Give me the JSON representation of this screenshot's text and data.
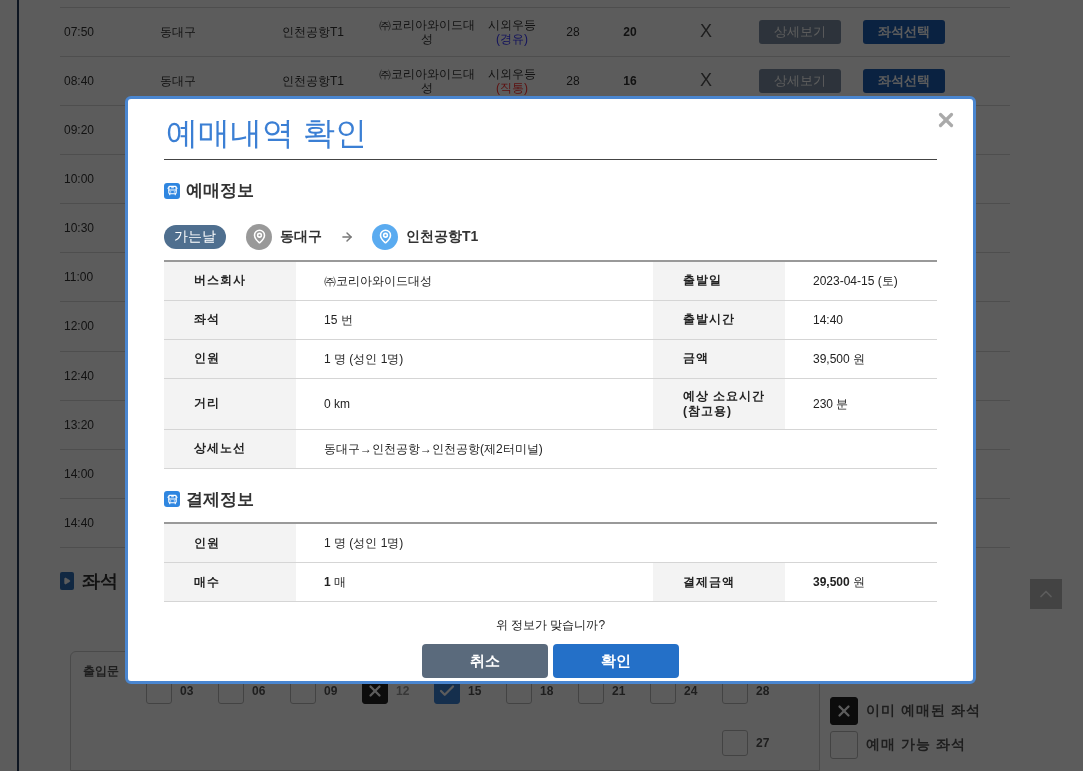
{
  "schedule": {
    "rows": [
      {
        "time": "07:50",
        "departure": "동대구",
        "arrival": "인천공항T1",
        "company": "㈜코리아와이드대성",
        "grade": "시외우등",
        "grade_note": {
          "text": "(경유)",
          "kind": "via"
        },
        "total_seats": "28",
        "remaining_seats": "20",
        "mark": "X",
        "detail_button": "상세보기",
        "select_button": "좌석선택"
      },
      {
        "time": "08:40",
        "departure": "동대구",
        "arrival": "인천공항T1",
        "company": "㈜코리아와이드대성",
        "grade": "시외우등",
        "grade_note": {
          "text": "(직통)",
          "kind": "direct"
        },
        "total_seats": "28",
        "remaining_seats": "16",
        "mark": "X",
        "detail_button": "상세보기",
        "select_button": "좌석선택"
      },
      {
        "time": "09:20"
      },
      {
        "time": "10:00"
      },
      {
        "time": "10:30"
      },
      {
        "time": "11:00"
      },
      {
        "time": "12:00"
      },
      {
        "time": "12:40"
      },
      {
        "time": "13:20"
      },
      {
        "time": "14:00"
      },
      {
        "time": "14:40"
      }
    ]
  },
  "seat_section": {
    "heading": "좌석",
    "door_label": "출입문",
    "seat_rows": [
      [
        {
          "number": "03",
          "booked": false,
          "selected": false
        },
        {
          "number": "06",
          "booked": false,
          "selected": false
        },
        {
          "number": "09",
          "booked": false,
          "selected": false
        },
        {
          "number": "12",
          "booked": true,
          "selected": false
        },
        {
          "number": "15",
          "booked": false,
          "selected": true
        },
        {
          "number": "18",
          "booked": false,
          "selected": false
        },
        {
          "number": "21",
          "booked": false,
          "selected": false
        },
        {
          "number": "24",
          "booked": false,
          "selected": false
        },
        {
          "number": "28",
          "booked": false,
          "selected": false
        }
      ],
      [
        {
          "number": "27",
          "booked": false,
          "selected": false
        }
      ]
    ],
    "legend": [
      {
        "kind": "booked",
        "label": "이미 예매된 좌석"
      },
      {
        "kind": "available",
        "label": "예매 가능 좌석"
      }
    ]
  },
  "modal": {
    "title": "예매내역 확인",
    "booking_info": {
      "heading": "예매정보",
      "direction": "가는날",
      "from": "동대구",
      "to": "인천공항T1",
      "rows": [
        {
          "cells": [
            {
              "label": "버스회사",
              "value": "㈜코리아와이드대성"
            },
            {
              "label": "출발일",
              "value": "2023-04-15 (토)"
            }
          ]
        },
        {
          "cells": [
            {
              "label": "좌석",
              "value": "15 번"
            },
            {
              "label": "출발시간",
              "value": "14:40"
            }
          ]
        },
        {
          "cells": [
            {
              "label": "인원",
              "value": "1 명 (성인 1명)"
            },
            {
              "label": "금액",
              "value": "39,500 원"
            }
          ]
        },
        {
          "cells": [
            {
              "label": "거리",
              "value": "0 km"
            },
            {
              "label": "예상 소요시간 (참고용)",
              "value": "230 분"
            }
          ]
        },
        {
          "cells": [
            {
              "label": "상세노선",
              "value": "동대구→인천공항→인천공항(제2터미널)"
            }
          ]
        }
      ]
    },
    "payment_info": {
      "heading": "결제정보",
      "rows": [
        {
          "cells": [
            {
              "label": "인원",
              "value": "1 명 (성인 1명)"
            }
          ]
        },
        {
          "cells": [
            {
              "label": "매수",
              "value": "**1** 매"
            },
            {
              "label": "결제금액",
              "value": "**39,500** 원"
            }
          ]
        }
      ]
    },
    "question": "위 정보가 맞습니까?",
    "cancel_button": "취소",
    "confirm_button": "확인"
  }
}
